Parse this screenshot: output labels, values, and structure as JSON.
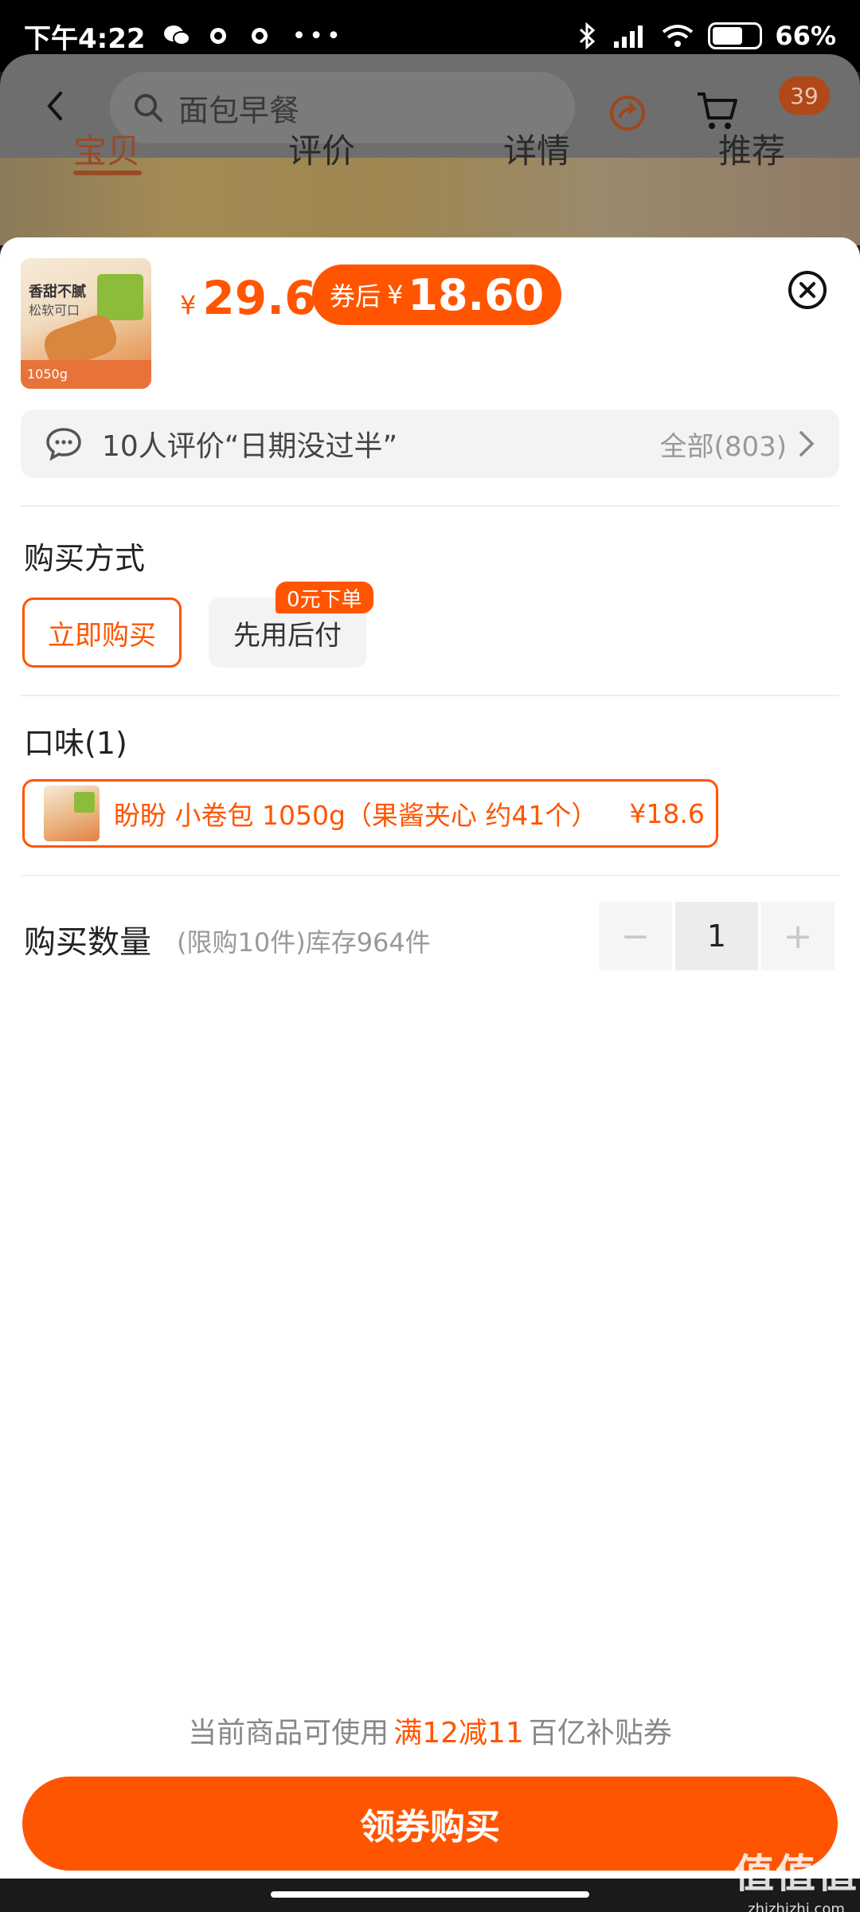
{
  "status_bar": {
    "time": "下午4:22",
    "dots": "•••",
    "battery_pct": "66%"
  },
  "header": {
    "search_placeholder": "面包早餐",
    "cart_badge": "39",
    "tabs": [
      {
        "label": "宝贝",
        "active": true
      },
      {
        "label": "评价",
        "active": false
      },
      {
        "label": "详情",
        "active": false
      },
      {
        "label": "推荐",
        "active": false
      }
    ]
  },
  "product": {
    "thumb_line1": "香甜不腻",
    "thumb_line2": "松软可口",
    "thumb_weight": "1050g",
    "price_symbol": "¥",
    "price": "29.6",
    "coupon_tag": "券后",
    "coupon_symbol": "¥",
    "coupon_price": "18.60"
  },
  "review": {
    "text": "10人评价“日期没过半”",
    "all_label": "全部(803)"
  },
  "purchase_method": {
    "title": "购买方式",
    "options": [
      "立即购买",
      "先用后付"
    ],
    "badge": "0元下单"
  },
  "flavor": {
    "title": "口味(1)",
    "item_name": "盼盼 小卷包 1050g（果酱夹心 约41个）",
    "item_price": "¥18.6"
  },
  "quantity": {
    "title": "购买数量",
    "note": "(限购10件)库存964件",
    "minus": "−",
    "value": "1",
    "plus": "+"
  },
  "coupon_note": {
    "prefix": "当前商品可使用",
    "highlight": "满12减11",
    "suffix": "百亿补贴券"
  },
  "cta": {
    "label": "领券购买"
  },
  "watermark": {
    "main": "值值值",
    "sub": "zhizhizhi.com"
  },
  "colors": {
    "accent": "#ff5500",
    "review_bg": "#f3f3f3"
  }
}
